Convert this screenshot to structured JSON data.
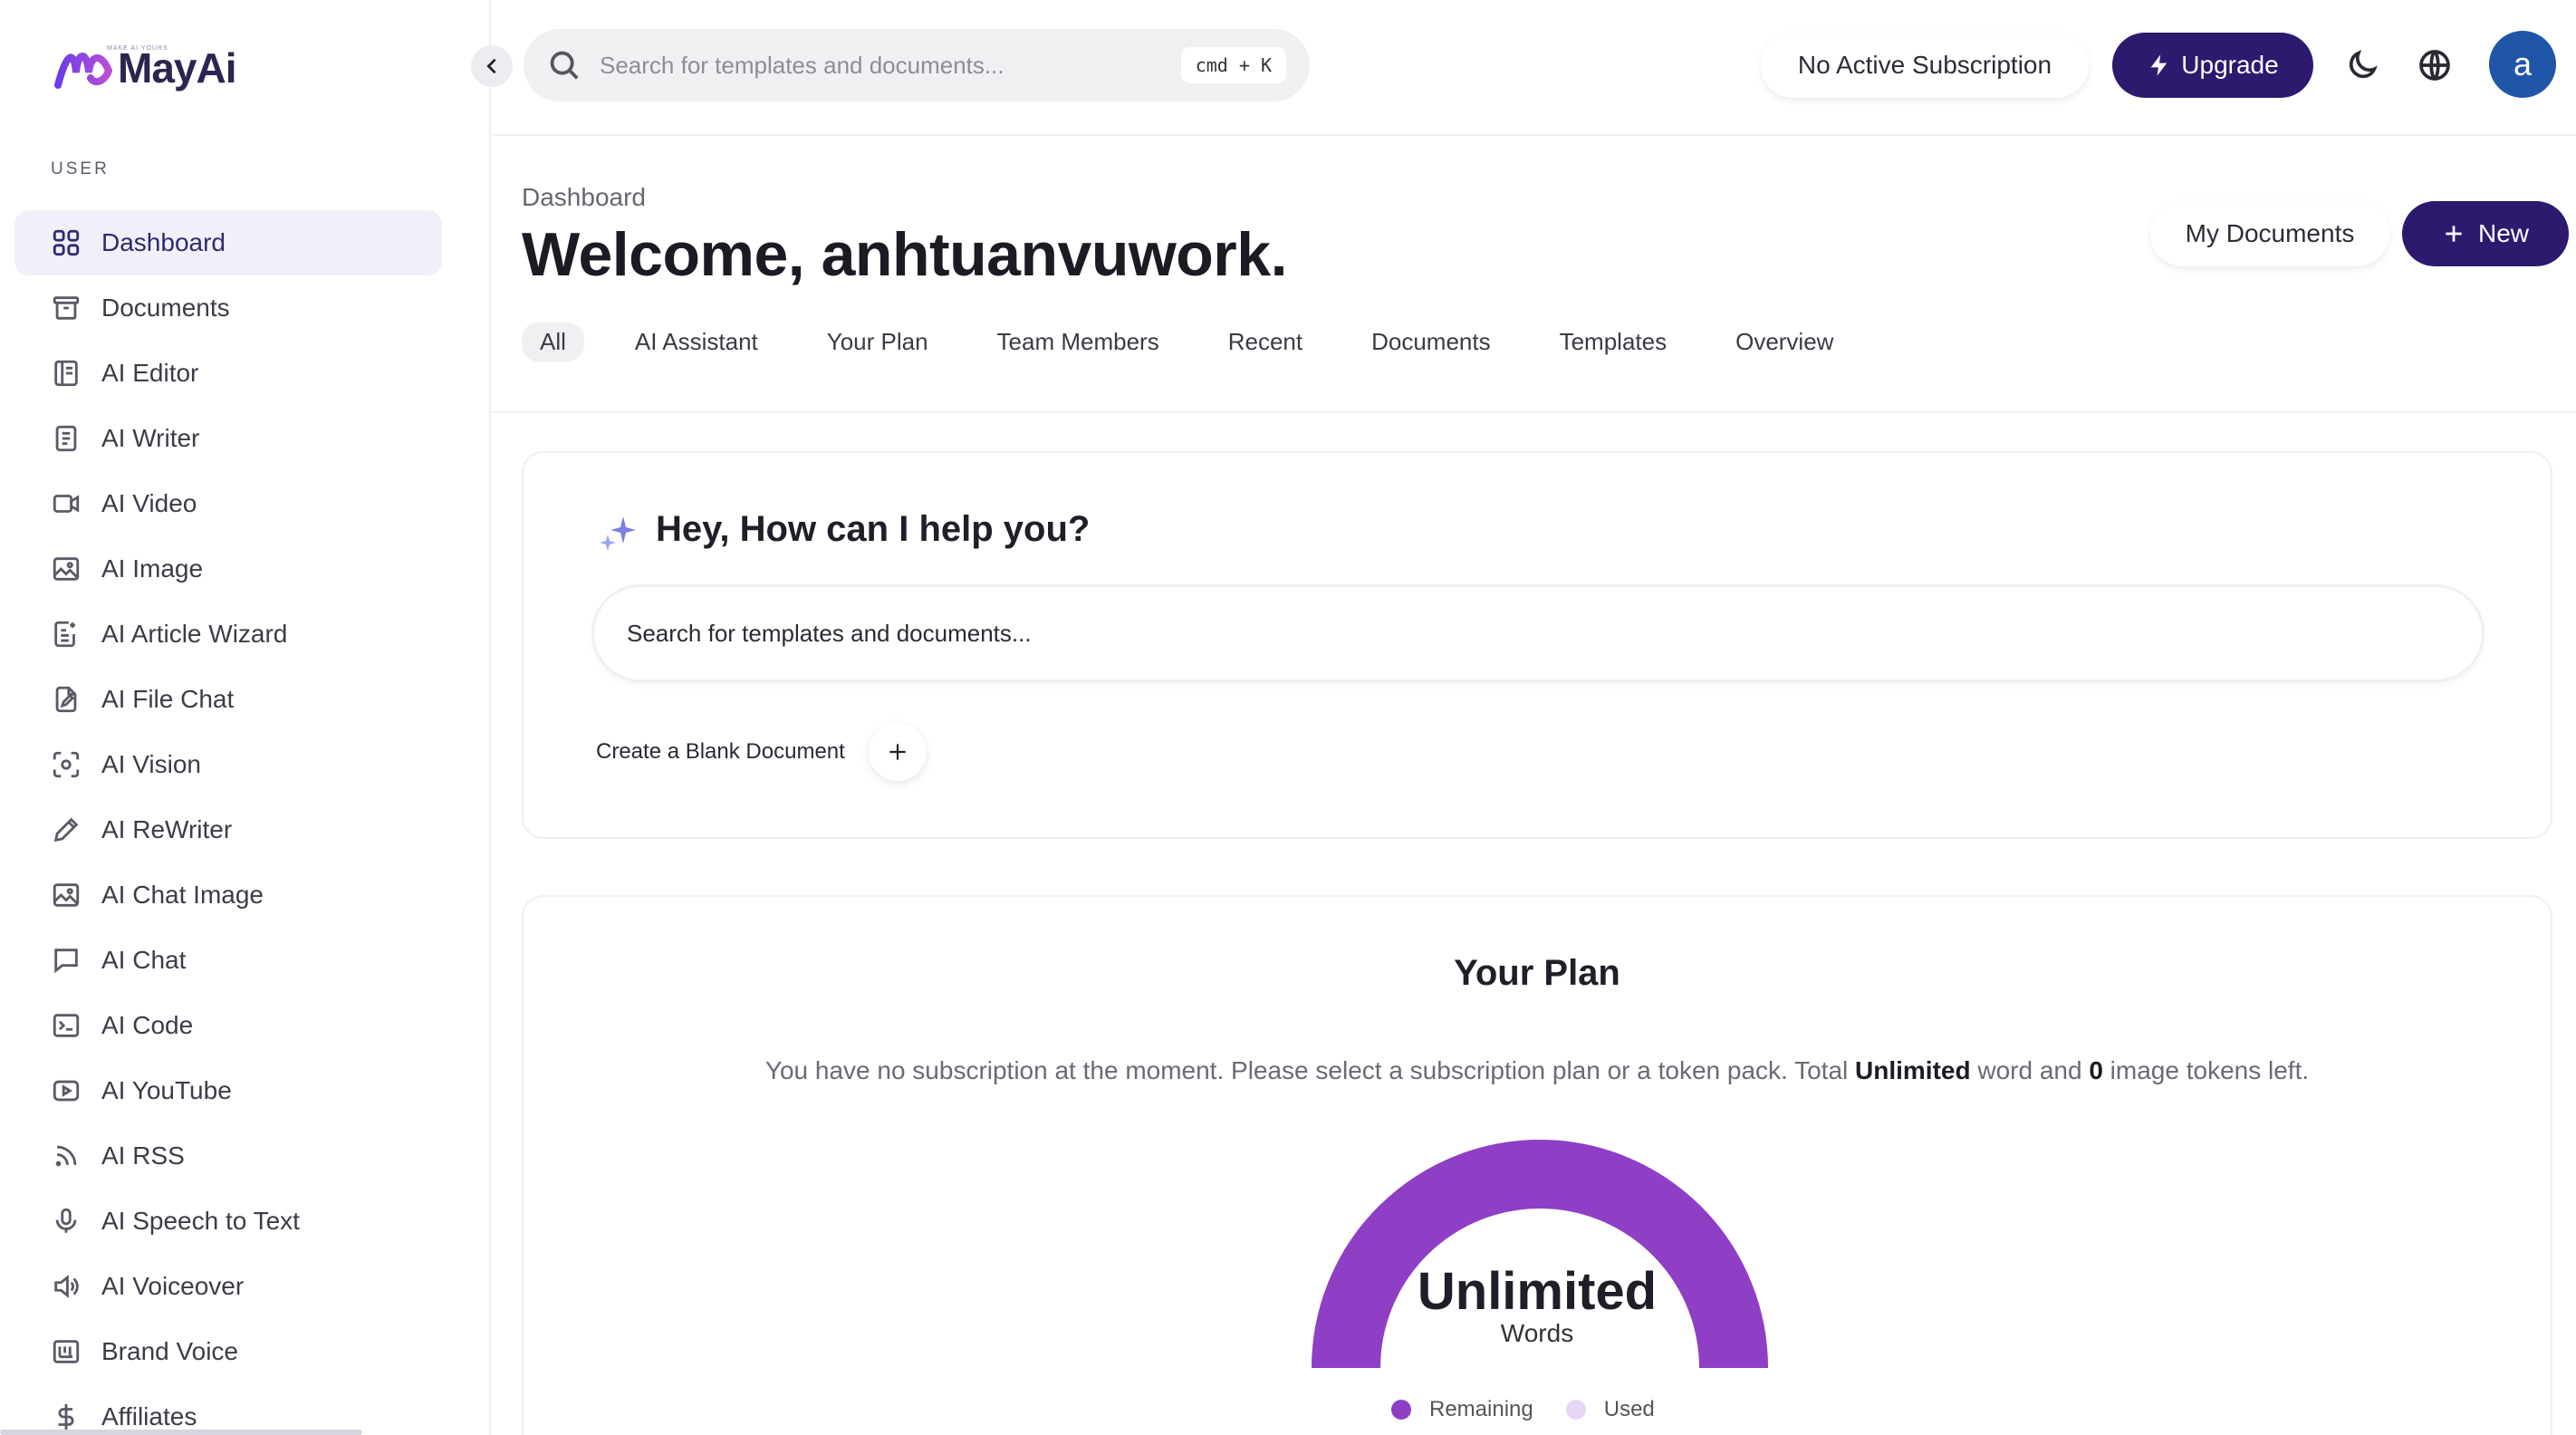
{
  "app": {
    "logo_text": "MayAi",
    "logo_tagline": "MAKE AI YOURS",
    "brand_color": "#2d1a6e"
  },
  "sidebar": {
    "section_label": "USER",
    "items": [
      {
        "label": "Dashboard",
        "icon": "grid-icon",
        "active": true
      },
      {
        "label": "Documents",
        "icon": "archive-icon"
      },
      {
        "label": "AI Editor",
        "icon": "book-icon"
      },
      {
        "label": "AI Writer",
        "icon": "document-icon"
      },
      {
        "label": "AI Video",
        "icon": "video-icon"
      },
      {
        "label": "AI Image",
        "icon": "image-icon"
      },
      {
        "label": "AI Article Wizard",
        "icon": "article-wand-icon"
      },
      {
        "label": "AI File Chat",
        "icon": "file-edit-icon"
      },
      {
        "label": "AI Vision",
        "icon": "scan-eye-icon"
      },
      {
        "label": "AI ReWriter",
        "icon": "pencil-icon"
      },
      {
        "label": "AI Chat Image",
        "icon": "image-icon"
      },
      {
        "label": "AI Chat",
        "icon": "chat-bubble-icon"
      },
      {
        "label": "AI Code",
        "icon": "terminal-icon"
      },
      {
        "label": "AI YouTube",
        "icon": "youtube-icon"
      },
      {
        "label": "AI RSS",
        "icon": "rss-icon"
      },
      {
        "label": "AI Speech to Text",
        "icon": "microphone-icon"
      },
      {
        "label": "AI Voiceover",
        "icon": "speaker-icon"
      },
      {
        "label": "Brand Voice",
        "icon": "brand-icon"
      },
      {
        "label": "Affiliates",
        "icon": "dollar-icon"
      }
    ]
  },
  "topbar": {
    "search_placeholder": "Search for templates and documents...",
    "shortcut": "cmd + K",
    "subscription_status": "No Active Subscription",
    "upgrade_label": "Upgrade",
    "avatar_letter": "a"
  },
  "header": {
    "breadcrumb": "Dashboard",
    "welcome": "Welcome, anhtuanvuwork.",
    "my_documents_label": "My Documents",
    "new_label": "New",
    "tabs": [
      "All",
      "AI Assistant",
      "Your Plan",
      "Team Members",
      "Recent",
      "Documents",
      "Templates",
      "Overview"
    ],
    "active_tab": "All"
  },
  "assistant": {
    "title": "Hey, How can I help you?",
    "search_placeholder": "Search for templates and documents...",
    "blank_doc_label": "Create a Blank Document"
  },
  "plan": {
    "title": "Your Plan",
    "desc_prefix": "You have no subscription at the moment. Please select a subscription plan or a token pack. Total ",
    "word_tokens": "Unlimited",
    "desc_middle": " word and ",
    "image_tokens": "0",
    "desc_suffix": " image tokens left.",
    "gauge_value": "Unlimited",
    "gauge_unit": "Words",
    "remaining_fraction": 1.0,
    "legend": [
      {
        "label": "Remaining",
        "color": "#8e3fc6"
      },
      {
        "label": "Used",
        "color": "#e6d5f4"
      }
    ]
  }
}
